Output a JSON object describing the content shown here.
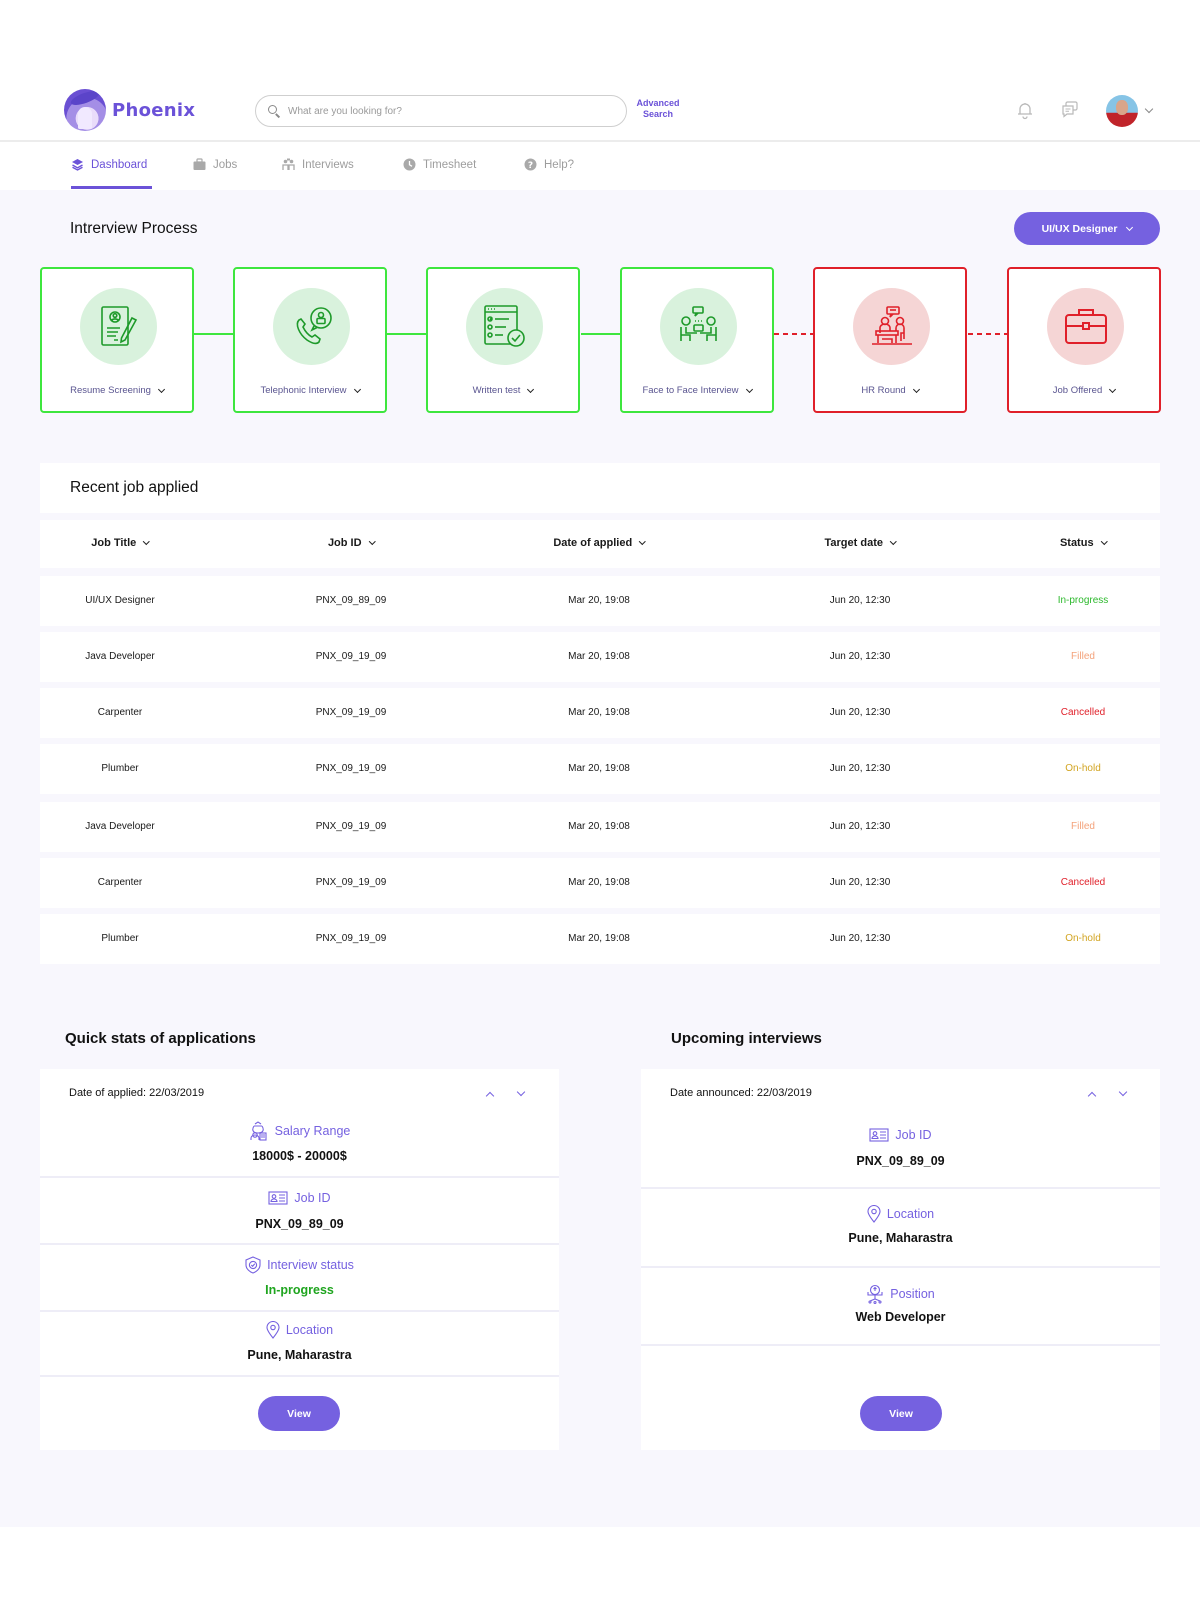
{
  "header": {
    "brand": "Phoenix",
    "search_placeholder": "What are you looking for?",
    "advanced_search": "Advanced Search"
  },
  "nav": {
    "items": [
      {
        "label": "Dashboard",
        "icon": "layers-icon",
        "active": true
      },
      {
        "label": "Jobs",
        "icon": "briefcase-icon",
        "active": false
      },
      {
        "label": "Interviews",
        "icon": "people-icon",
        "active": false
      },
      {
        "label": "Timesheet",
        "icon": "clock-icon",
        "active": false
      },
      {
        "label": "Help?",
        "icon": "help-icon",
        "active": false
      }
    ]
  },
  "process": {
    "title": "Intrerview Process",
    "role_selector": "UI/UX Designer",
    "steps": [
      {
        "label": "Resume Screening",
        "icon": "resume-icon",
        "state": "completed"
      },
      {
        "label": "Telephonic Interview",
        "icon": "phone-call-icon",
        "state": "completed"
      },
      {
        "label": "Written test",
        "icon": "written-test-icon",
        "state": "completed"
      },
      {
        "label": "Face to Face Interview",
        "icon": "face-to-face-icon",
        "state": "completed"
      },
      {
        "label": "HR Round",
        "icon": "hr-round-icon",
        "state": "pending"
      },
      {
        "label": "Job Offered",
        "icon": "briefcase-icon",
        "state": "pending"
      }
    ],
    "colors": {
      "completed": "#3ee63e",
      "pending": "#e0202a"
    }
  },
  "recent_jobs": {
    "title": "Recent job applied",
    "columns": [
      "Job Title",
      "Job ID",
      "Date of applied",
      "Target date",
      "Status"
    ],
    "rows": [
      {
        "title": "UI/UX Designer",
        "job_id": "PNX_09_89_09",
        "applied": "Mar 20, 19:08",
        "target": "Jun 20, 12:30",
        "status": "In-progress",
        "status_color": "#2db92d"
      },
      {
        "title": "Java Developer",
        "job_id": "PNX_09_19_09",
        "applied": "Mar 20, 19:08",
        "target": "Jun 20, 12:30",
        "status": "Filled",
        "status_color": "#f4a27a"
      },
      {
        "title": "Carpenter",
        "job_id": "PNX_09_19_09",
        "applied": "Mar 20, 19:08",
        "target": "Jun 20, 12:30",
        "status": "Cancelled",
        "status_color": "#e0202a"
      },
      {
        "title": "Plumber",
        "job_id": "PNX_09_19_09",
        "applied": "Mar 20, 19:08",
        "target": "Jun 20, 12:30",
        "status": "On-hold",
        "status_color": "#d2a421"
      },
      {
        "title": "Java Developer",
        "job_id": "PNX_09_19_09",
        "applied": "Mar 20, 19:08",
        "target": "Jun 20, 12:30",
        "status": "Filled",
        "status_color": "#f4a27a"
      },
      {
        "title": "Carpenter",
        "job_id": "PNX_09_19_09",
        "applied": "Mar 20, 19:08",
        "target": "Jun 20, 12:30",
        "status": "Cancelled",
        "status_color": "#e0202a"
      },
      {
        "title": "Plumber",
        "job_id": "PNX_09_19_09",
        "applied": "Mar 20, 19:08",
        "target": "Jun 20, 12:30",
        "status": "On-hold",
        "status_color": "#d2a421"
      }
    ]
  },
  "quick_stats": {
    "title": "Quick stats of applications",
    "date_line": "Date of applied: 22/03/2019",
    "items": [
      {
        "label": "Salary Range",
        "icon": "salary-icon",
        "value": "18000$ - 20000$"
      },
      {
        "label": "Job ID",
        "icon": "id-card-icon",
        "value": "PNX_09_89_09"
      },
      {
        "label": "Interview status",
        "icon": "shield-check-icon",
        "value": "In-progress",
        "value_color": "#1fa51f"
      },
      {
        "label": "Location",
        "icon": "location-pin-icon",
        "value": "Pune, Maharastra"
      }
    ],
    "button": "View"
  },
  "upcoming": {
    "title": "Upcoming interviews",
    "date_line": "Date announced: 22/03/2019",
    "items": [
      {
        "label": "Job ID",
        "icon": "id-card-icon",
        "value": "PNX_09_89_09"
      },
      {
        "label": "Location",
        "icon": "location-pin-icon",
        "value": "Pune, Maharastra"
      },
      {
        "label": "Position",
        "icon": "position-icon",
        "value": "Web Developer"
      }
    ],
    "button": "View"
  },
  "colors": {
    "accent": "#7561e0",
    "page_bg": "#f8f7fd"
  }
}
